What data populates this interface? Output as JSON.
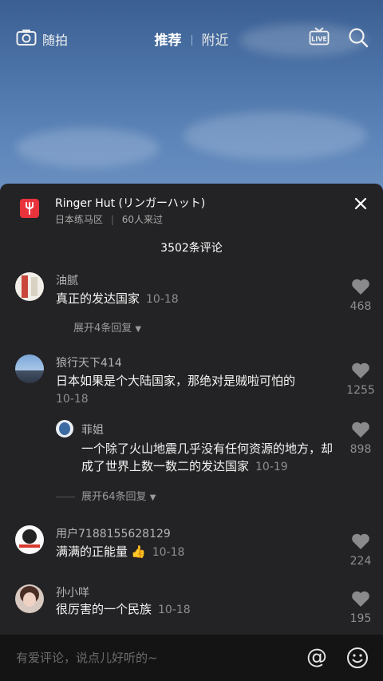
{
  "top_bar": {
    "camera_label": "随拍",
    "tab_recommend": "推荐",
    "tab_nearby": "附近"
  },
  "header": {
    "shop_name": "Ringer Hut (リンガーハット)",
    "location": "日本练马区",
    "visitors": "60人来过",
    "comment_count": "3502条评论"
  },
  "comments": [
    {
      "user": "油腻",
      "text": "真正的发达国家",
      "time": "10-18",
      "likes": "468",
      "expand": "展开4条回复"
    },
    {
      "user": "狼行天下414",
      "text": "日本如果是个大陆国家，那绝对是贼啦可怕的",
      "time": "10-18",
      "likes": "1255",
      "reply": {
        "user": "菲姐",
        "text": "一个除了火山地震几乎没有任何资源的地方，却成了世界上数一数二的发达国家",
        "time": "10-19",
        "likes": "898"
      },
      "expand": "展开64条回复"
    },
    {
      "user": "用户7188155628129",
      "text": "满满的正能量",
      "time": "10-18",
      "likes": "224"
    },
    {
      "user": "孙小咩",
      "text": "很厉害的一个民族",
      "time": "10-18",
      "likes": "195"
    }
  ],
  "input": {
    "placeholder": "有爱评论，说点儿好听的~",
    "at_symbol": "@"
  },
  "colors": {
    "brand": "#e8323c",
    "panel": "#232325"
  }
}
